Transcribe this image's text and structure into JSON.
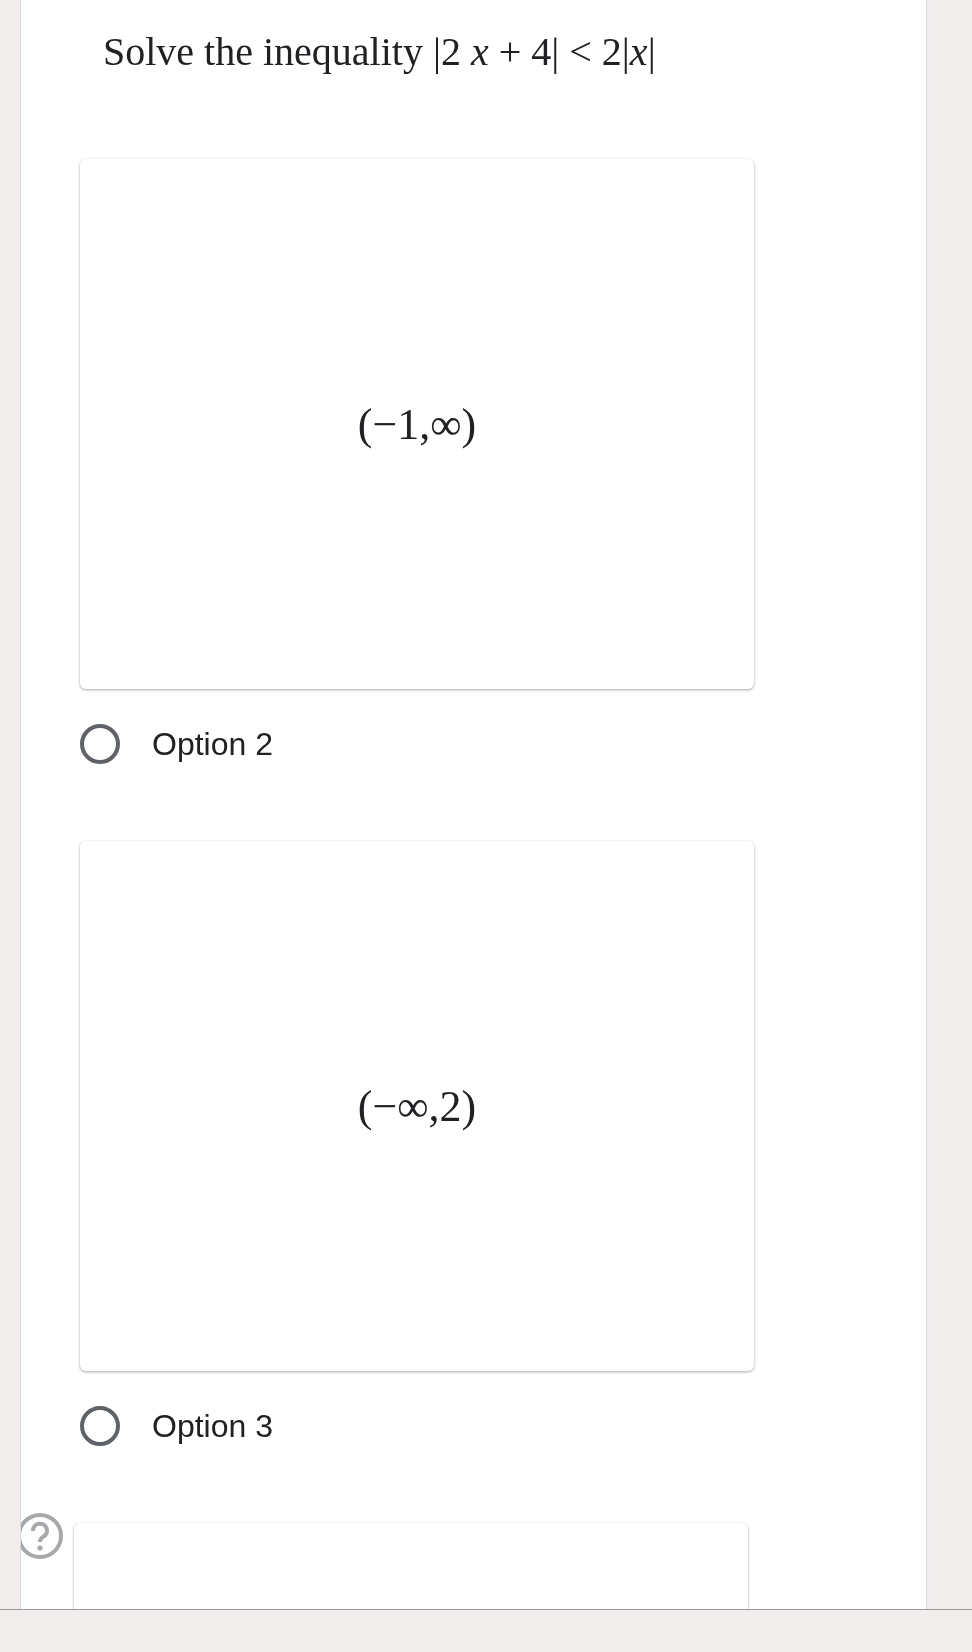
{
  "question": {
    "text": "Solve the inequality |2 *x* + 4| < 2|*x*|"
  },
  "options": [
    {
      "kind": "full",
      "image_text": "(−1,∞)",
      "label": "Option 2",
      "selected": false
    },
    {
      "kind": "full",
      "image_text": "(−∞,2)",
      "label": "Option 3",
      "selected": false
    },
    {
      "kind": "cut",
      "help": true
    }
  ]
}
